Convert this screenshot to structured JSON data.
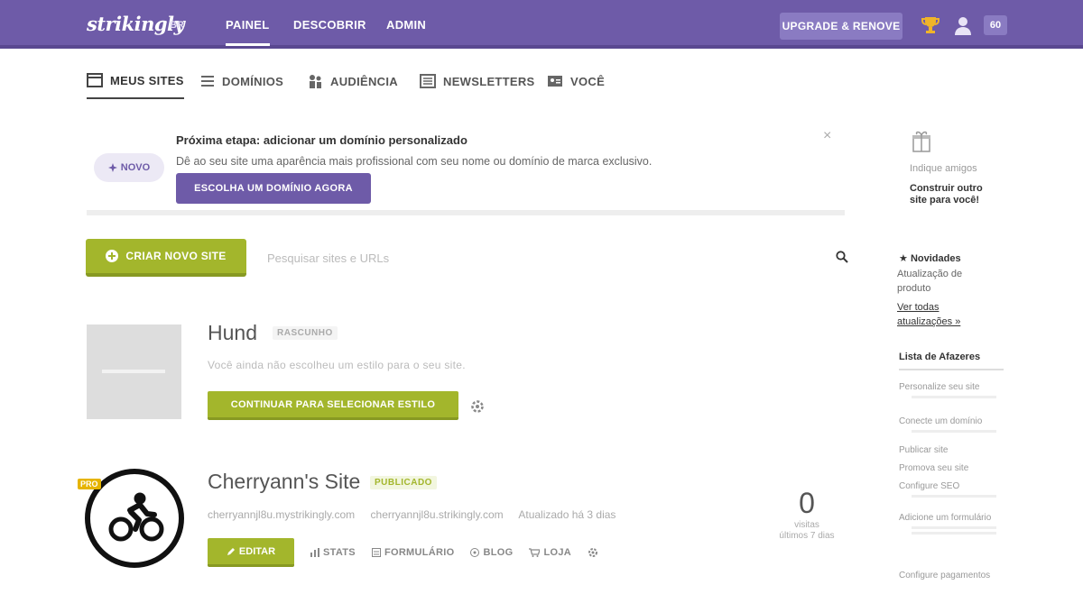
{
  "topbar": {
    "logo": "strikingly",
    "logo_lang": "BR",
    "nav": [
      "PAINEL",
      "DESCOBRIR",
      "ADMIN"
    ],
    "upgrade_label": "UPGRADE & RENOVE",
    "zoom_badge": "60"
  },
  "subnav": {
    "items": [
      {
        "label": "MEUS SITES",
        "icon": "browser-window-icon"
      },
      {
        "label": "DOMÍNIOS",
        "icon": "list-icon"
      },
      {
        "label": "AUDIÊNCIA",
        "icon": "people-icon"
      },
      {
        "label": "NEWSLETTERS",
        "icon": "newspaper-icon"
      },
      {
        "label": "VOCÊ",
        "icon": "person-card-icon"
      }
    ]
  },
  "notice": {
    "badge": "NOVO",
    "title": "Próxima etapa: adicionar um domínio personalizado",
    "text": "Dê ao seu site uma aparência mais profissional com seu nome ou domínio de marca exclusivo.",
    "button": "ESCOLHA UM DOMÍNIO AGORA",
    "close": "×"
  },
  "actions": {
    "create_button": "CRIAR NOVO SITE",
    "search_placeholder": "Pesquisar sites e URLs"
  },
  "sites": [
    {
      "title": "Hund",
      "status": "RASCUNHO",
      "description": "Você ainda não escolheu um estilo para o seu site.",
      "continue_button": "CONTINUAR PARA SELECIONAR ESTILO"
    },
    {
      "title": "Cherryann's Site",
      "status": "PUBLICADO",
      "pro_badge": "PRO",
      "links": [
        "cherryannjl8u.mystrikingly.com",
        "cherryannjl8u.strikingly.com",
        "Atualizado há 3 dias"
      ],
      "buttons": [
        "EDITAR",
        "STATS",
        "FORMULÁRIO",
        "BLOG",
        "LOJA"
      ],
      "visits": "0",
      "visits_label": [
        "visitas",
        "últimos 7 dias"
      ]
    }
  ],
  "sidebar": {
    "promo_small": "Indique amigos",
    "promo_bold": "Construir outro site para você!",
    "news_head": "Novidades",
    "news_text": "Atualização de produto",
    "news_link": "Ver todas atualizações »",
    "checklist_head": "Lista de Afazeres",
    "checklist": [
      "Personalize seu site",
      "Conecte um domínio",
      "Publicar site",
      "Promova seu site",
      "Configure SEO",
      "Adicione um formulário",
      "Configure pagamentos"
    ]
  },
  "colors": {
    "brand": "#6e5ba8",
    "accent": "#a3b62c",
    "draft": "#b7b7b7",
    "pro": "#e6b400"
  }
}
